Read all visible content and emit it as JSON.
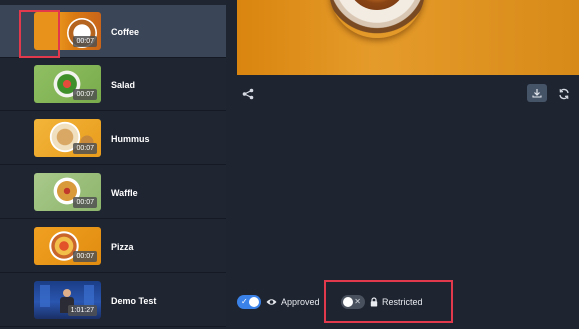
{
  "list": {
    "items": [
      {
        "title": "Coffee",
        "duration": "00:07",
        "selected": true,
        "thumb": "coffee"
      },
      {
        "title": "Salad",
        "duration": "00:07",
        "selected": false,
        "thumb": "salad"
      },
      {
        "title": "Hummus",
        "duration": "00:07",
        "selected": false,
        "thumb": "hummus"
      },
      {
        "title": "Waffle",
        "duration": "00:07",
        "selected": false,
        "thumb": "waffle"
      },
      {
        "title": "Pizza",
        "duration": "00:07",
        "selected": false,
        "thumb": "pizza"
      },
      {
        "title": "Demo Test",
        "duration": "1:01:27",
        "selected": false,
        "thumb": "demo"
      }
    ]
  },
  "toolbar": {
    "share_icon": "share-icon",
    "download_icon": "download-icon",
    "refresh_icon": "refresh-icon"
  },
  "toggles": {
    "approved": {
      "label": "Approved",
      "state": "on",
      "icon": "eye-icon",
      "mark": "✓"
    },
    "restricted": {
      "label": "Restricted",
      "state": "off",
      "icon": "lock-icon",
      "mark": "✕"
    }
  },
  "colors": {
    "accent": "#3b82e8",
    "highlight": "#e2394d",
    "selected_row": "#3a4557"
  }
}
